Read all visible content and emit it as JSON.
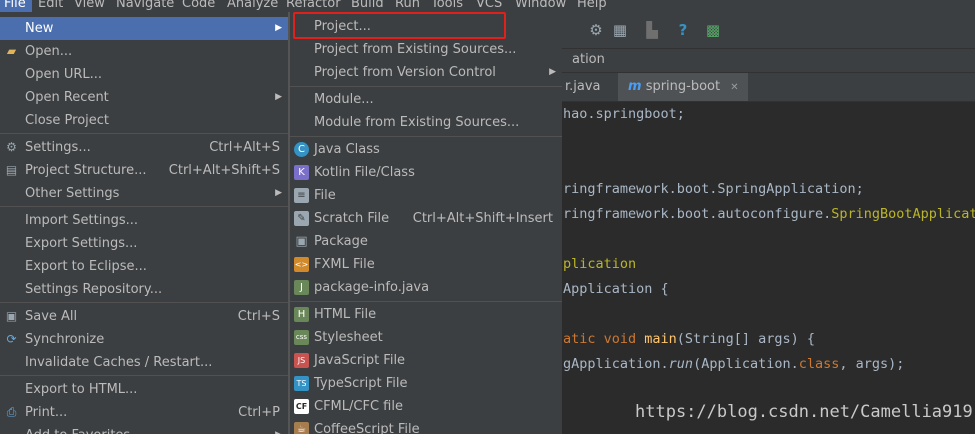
{
  "menubar": {
    "items": [
      "File",
      "Edit",
      "View",
      "Navigate",
      "Code",
      "Analyze",
      "Refactor",
      "Build",
      "Run",
      "Tools",
      "VCS",
      "Window",
      "Help"
    ]
  },
  "toolbar": {
    "icons": [
      "pin-icon",
      "database-icon",
      "stop-icon",
      "help-icon",
      "plugin-icon"
    ]
  },
  "navbar": {
    "breadcrumb": "ation"
  },
  "tabs": [
    {
      "label": "r.java"
    },
    {
      "label": "spring-boot",
      "icon": "m"
    }
  ],
  "editor": {
    "lines": [
      "hao.springboot;",
      "ringframework.boot.SpringApplication;",
      "ringframework.boot.autoconfigure.",
      "SpringBootApplicati",
      "plication",
      "Application {",
      "atic void ",
      "main",
      "(String[] args) {",
      "gApplication.",
      "run",
      "(Application.",
      "class",
      ", args);"
    ]
  },
  "watermark": "https://blog.csdn.net/Camellia919",
  "file_menu": {
    "items": [
      {
        "label": "New",
        "submenu": true,
        "selected": true
      },
      {
        "label": "Open...",
        "icon": "folder-icon"
      },
      {
        "label": "Open URL..."
      },
      {
        "label": "Open Recent",
        "submenu": true
      },
      {
        "label": "Close Project"
      },
      {
        "label": "Settings...",
        "shortcut": "Ctrl+Alt+S",
        "icon": "settings-icon"
      },
      {
        "label": "Project Structure...",
        "shortcut": "Ctrl+Alt+Shift+S",
        "icon": "project-structure-icon"
      },
      {
        "label": "Other Settings",
        "submenu": true
      },
      {
        "label": "Import Settings..."
      },
      {
        "label": "Export Settings..."
      },
      {
        "label": "Export to Eclipse..."
      },
      {
        "label": "Settings Repository..."
      },
      {
        "label": "Save All",
        "shortcut": "Ctrl+S",
        "icon": "save-icon"
      },
      {
        "label": "Synchronize",
        "icon": "sync-icon"
      },
      {
        "label": "Invalidate Caches / Restart..."
      },
      {
        "label": "Export to HTML..."
      },
      {
        "label": "Print...",
        "shortcut": "Ctrl+P",
        "icon": "print-icon"
      },
      {
        "label": "Add to Favorites",
        "submenu": true
      }
    ]
  },
  "new_menu": {
    "items": [
      {
        "label": "Project..."
      },
      {
        "label": "Project from Existing Sources..."
      },
      {
        "label": "Project from Version Control",
        "submenu": true
      },
      {
        "label": "Module..."
      },
      {
        "label": "Module from Existing Sources..."
      },
      {
        "label": "Java Class",
        "icon": "C",
        "color": "#3592c4"
      },
      {
        "label": "Kotlin File/Class",
        "icon": "K",
        "color": "#7a6fc9"
      },
      {
        "label": "File",
        "icon": "≡",
        "color": "#9aa7b0"
      },
      {
        "label": "Scratch File",
        "shortcut": "Ctrl+Alt+Shift+Insert",
        "icon": "✎",
        "color": "#9aa7b0"
      },
      {
        "label": "Package",
        "icon": "▣",
        "color": "#9aa7b0"
      },
      {
        "label": "FXML File",
        "icon": "<>",
        "color": "#d08a2c"
      },
      {
        "label": "package-info.java",
        "icon": "J",
        "color": "#6a8759"
      },
      {
        "label": "HTML File",
        "icon": "H",
        "color": "#6a8759"
      },
      {
        "label": "Stylesheet",
        "icon": "css",
        "color": "#6a8759"
      },
      {
        "label": "JavaScript File",
        "icon": "JS",
        "color": "#c75450"
      },
      {
        "label": "TypeScript File",
        "icon": "TS",
        "color": "#3592c4"
      },
      {
        "label": "CFML/CFC file",
        "icon": "CF",
        "color": "#ffffff"
      },
      {
        "label": "CoffeeScript File",
        "icon": "☕",
        "color": "#a87d4e"
      }
    ]
  }
}
